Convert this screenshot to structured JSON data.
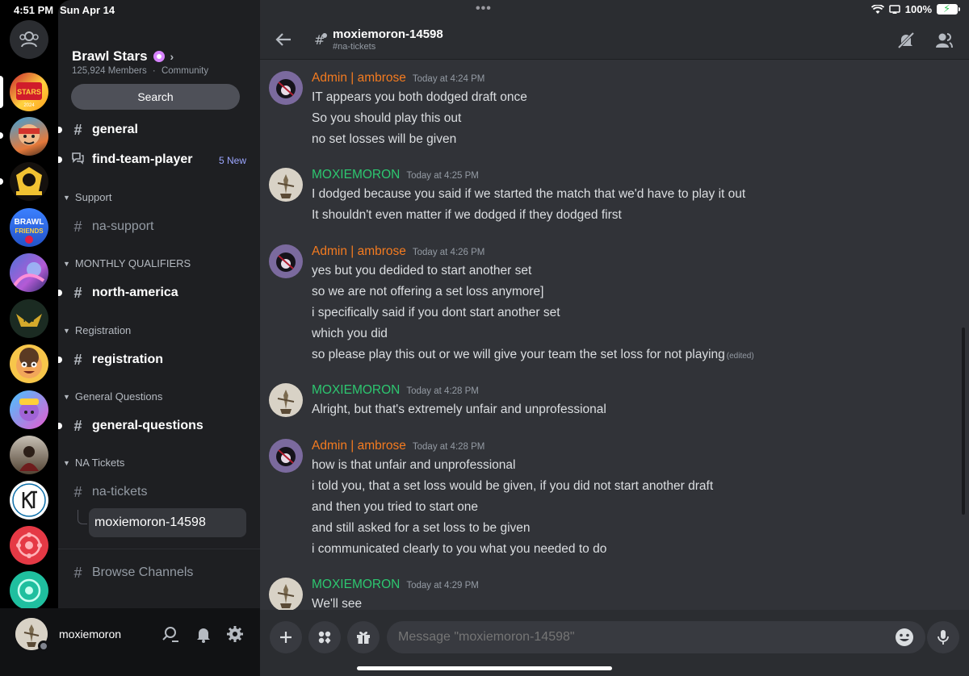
{
  "status_bar": {
    "time": "4:51 PM",
    "date": "Sun Apr 14",
    "battery": "100%"
  },
  "colors": {
    "admin": "#f47b20",
    "member": "#2dc770",
    "new_badge": "#9ca6ff"
  },
  "server": {
    "name": "Brawl Stars",
    "members": "125,924 Members",
    "type": "Community",
    "search_label": "Search"
  },
  "rail": {
    "icons": [
      "direct-messages-icon",
      "brawl-stars-championship-server",
      "brawler-server",
      "brawl-hub-server",
      "brawl-friends-server",
      "art-server",
      "esports-server",
      "emoji-server",
      "community-server",
      "kt-server",
      "red-server",
      "green-server"
    ]
  },
  "channels": {
    "general": "general",
    "find_team": "find-team-player",
    "find_team_badge": "5 New",
    "cat_support": "Support",
    "na_support": "na-support",
    "cat_monthly": "MONTHLY QUALIFIERS",
    "north_america": "north-america",
    "cat_registration": "Registration",
    "registration": "registration",
    "cat_general_questions": "General Questions",
    "general_questions": "general-questions",
    "cat_na_tickets": "NA Tickets",
    "na_tickets": "na-tickets",
    "thread": "moxiemoron-14598",
    "browse": "Browse Channels"
  },
  "user": {
    "name": "moxiemoron"
  },
  "chat": {
    "title": "moxiemoron-14598",
    "subtitle": "#na-tickets",
    "placeholder": "Message \"moxiemoron-14598\""
  },
  "messages": [
    {
      "author": "Admin | ambrose",
      "role": "admin",
      "time": "Today at 4:24 PM",
      "lines": [
        "IT appears you both dodged draft once",
        "So you should play this out",
        "no set losses will be given"
      ]
    },
    {
      "author": "MOXIEMORON",
      "role": "member",
      "time": "Today at 4:25 PM",
      "lines": [
        "I dodged because you said if we started the match that we'd have to play it out",
        "It shouldn't even matter if we dodged if they dodged first"
      ]
    },
    {
      "author": "Admin | ambrose",
      "role": "admin",
      "time": "Today at 4:26 PM",
      "lines": [
        "yes but you dedided to start another set",
        "so we are not offering a set loss anymore]",
        "i specifically said if you dont start another set",
        "which you did",
        "so please play this out or we will give your team the set loss for not playing"
      ],
      "edited": "(edited)"
    },
    {
      "author": "MOXIEMORON",
      "role": "member",
      "time": "Today at 4:28 PM",
      "lines": [
        "Alright, but that's extremely unfair and unprofessional"
      ]
    },
    {
      "author": "Admin | ambrose",
      "role": "admin",
      "time": "Today at 4:28 PM",
      "lines": [
        "how is that unfair and unprofessional",
        "i told you, that a set loss would be given, if you did not start another draft",
        "and then you tried to start one",
        "and still asked for a set loss to be given",
        "i communicated clearly to you what you needed to do"
      ]
    },
    {
      "author": "MOXIEMORON",
      "role": "member",
      "time": "Today at 4:29 PM",
      "lines": [
        "We'll see"
      ]
    }
  ]
}
